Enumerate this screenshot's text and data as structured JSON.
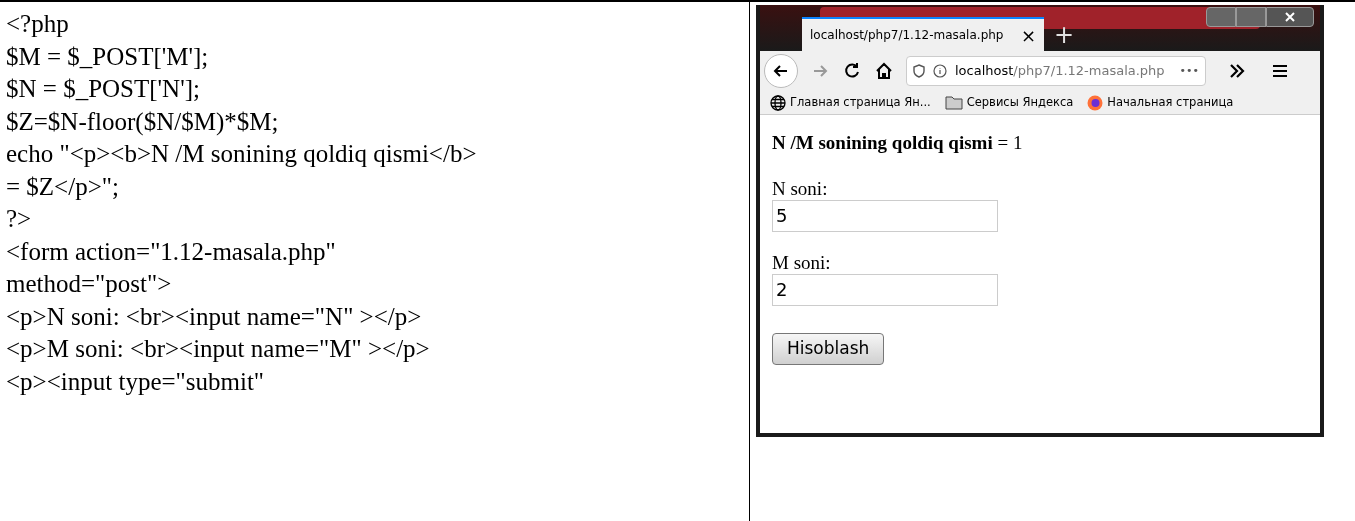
{
  "code_lines": [
    "<?php",
    "$M = $_POST['M'];",
    "$N = $_POST['N'];",
    "$Z=$N-floor($N/$M)*$M;",
    "echo \"<p><b>N /M sonining qoldiq qismi</b>",
    "= $Z</p>\";",
    "?>",
    "<form action=\"1.12-masala.php\"",
    "method=\"post\">",
    "<p>N soni: <br><input name=\"N\" ></p>",
    "<p>M soni: <br><input name=\"M\" ></p>",
    "<p><input type=\"submit\""
  ],
  "browser": {
    "tab": {
      "title": "localhost/php7/1.12-masala.php",
      "close": "×",
      "selected": true
    },
    "new_tab": "+",
    "url": {
      "host": "localhost",
      "path": "/php7/1.12-masala.php",
      "more": "•••"
    },
    "bookmarks": [
      {
        "kind": "globe",
        "label": "Главная страница Ян..."
      },
      {
        "kind": "folder",
        "label": "Сервисы Яндекса"
      },
      {
        "kind": "firefox",
        "label": "Начальная страница"
      }
    ],
    "page": {
      "result": "**N /M sonining qoldiq qismi** = 1",
      "fields": [
        {
          "label": "N soni:",
          "value": "5"
        },
        {
          "label": "M soni:",
          "value": "2"
        }
      ],
      "button": "Hisoblash"
    }
  }
}
